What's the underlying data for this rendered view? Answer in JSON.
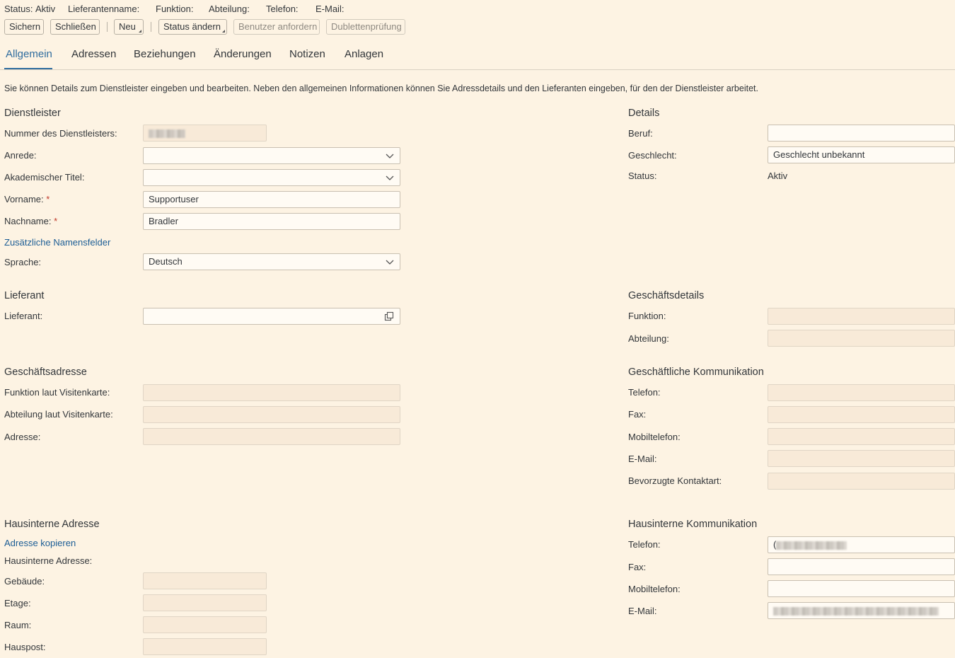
{
  "header": {
    "status_label": "Status:",
    "status_value": "Aktiv",
    "supplier_name_label": "Lieferantenname:",
    "function_label": "Funktion:",
    "department_label": "Abteilung:",
    "phone_label": "Telefon:",
    "email_label": "E-Mail:"
  },
  "toolbar": {
    "save": "Sichern",
    "close": "Schließen",
    "new": "Neu",
    "change_status": "Status ändern",
    "request_user": "Benutzer anfordern",
    "duplicate_check": "Dublettenprüfung"
  },
  "tabs": {
    "general": "Allgemein",
    "addresses": "Adressen",
    "relationships": "Beziehungen",
    "changes": "Änderungen",
    "notes": "Notizen",
    "attachments": "Anlagen"
  },
  "intro_text": "Sie können Details zum Dienstleister eingeben und bearbeiten. Neben den allgemeinen Informationen können Sie Adressdetails und den Lieferanten eingeben, für den der Dienstleister arbeitet.",
  "provider": {
    "title": "Dienstleister",
    "number_label": "Nummer des Dienstleisters:",
    "salutation_label": "Anrede:",
    "salutation_value": "",
    "academic_title_label": "Akademischer Titel:",
    "academic_title_value": "",
    "first_name_label": "Vorname:",
    "first_name_value": "Supportuser",
    "last_name_label": "Nachname:",
    "last_name_value": "Bradler",
    "required_mark": "*",
    "additional_names_link": "Zusätzliche Namensfelder",
    "language_label": "Sprache:",
    "language_value": "Deutsch"
  },
  "details": {
    "title": "Details",
    "profession_label": "Beruf:",
    "profession_value": "",
    "gender_label": "Geschlecht:",
    "gender_value": "Geschlecht unbekannt",
    "status_label": "Status:",
    "status_value": "Aktiv"
  },
  "supplier": {
    "title": "Lieferant",
    "supplier_label": "Lieferant:",
    "supplier_value": ""
  },
  "business_details": {
    "title": "Geschäftsdetails",
    "function_label": "Funktion:",
    "department_label": "Abteilung:"
  },
  "business_address": {
    "title": "Geschäftsadresse",
    "function_card_label": "Funktion laut Visitenkarte:",
    "department_card_label": "Abteilung laut Visitenkarte:",
    "address_label": "Adresse:"
  },
  "business_communication": {
    "title": "Geschäftliche Kommunikation",
    "phone_label": "Telefon:",
    "fax_label": "Fax:",
    "mobile_label": "Mobiltelefon:",
    "email_label": "E-Mail:",
    "preferred_contact_label": "Bevorzugte Kontaktart:"
  },
  "internal_address": {
    "title": "Hausinterne Adresse",
    "copy_link": "Adresse kopieren",
    "internal_address_label": "Hausinterne Adresse:",
    "building_label": "Gebäude:",
    "floor_label": "Etage:",
    "room_label": "Raum:",
    "mailbox_label": "Hauspost:"
  },
  "internal_communication": {
    "title": "Hausinterne Kommunikation",
    "phone_label": "Telefon:",
    "phone_prefix": "(",
    "fax_label": "Fax:",
    "mobile_label": "Mobiltelefon:",
    "email_label": "E-Mail:"
  },
  "icons": {
    "dropdown": "chevron-down-icon",
    "value_help": "value-help-icon",
    "menu_button": "menu-triangle-icon"
  },
  "colors": {
    "background": "#fdf3e3",
    "link": "#1c5d95",
    "active_tab": "#2f6c9e",
    "required": "#c0392b",
    "readonly_field": "#f8ead8"
  }
}
